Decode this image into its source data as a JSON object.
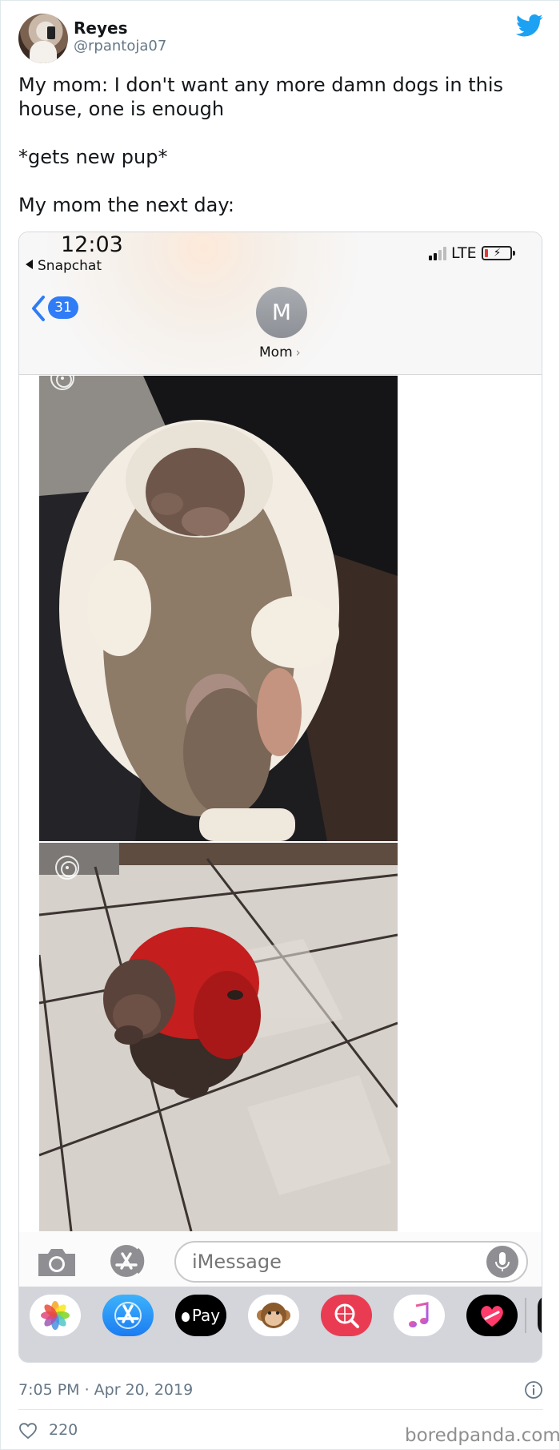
{
  "author": {
    "name": "Reyes",
    "handle": "@rpantoja07"
  },
  "tweet": {
    "lines": [
      "My mom: I don't want any more damn dogs in this house, one is enough",
      "*gets new pup*",
      "My mom the next day:"
    ]
  },
  "screenshot": {
    "time": "12:03",
    "back_app": "Snapchat",
    "network": "LTE",
    "unread_count": "31",
    "contact_initial": "M",
    "contact_name": "Mom",
    "message_placeholder": "iMessage",
    "tray_apps": [
      {
        "name": "Photos",
        "icon": "photos-icon"
      },
      {
        "name": "App Store",
        "icon": "appstore-icon"
      },
      {
        "name": "Pay",
        "label": "Pay",
        "icon": "apple-pay-icon"
      },
      {
        "name": "Animoji",
        "icon": "monkey-icon"
      },
      {
        "name": "Images",
        "icon": "globe-search-icon"
      },
      {
        "name": "Music",
        "icon": "music-note-icon"
      },
      {
        "name": "Digital Touch",
        "icon": "heart-touch-icon"
      }
    ]
  },
  "footer": {
    "timestamp": "7:05 PM · Apr 20, 2019",
    "likes": "220",
    "watermark": "boredpanda.com"
  },
  "colors": {
    "twitter_blue": "#1da1f2",
    "ios_blue": "#2f7cf6",
    "muted_text": "#657786"
  }
}
